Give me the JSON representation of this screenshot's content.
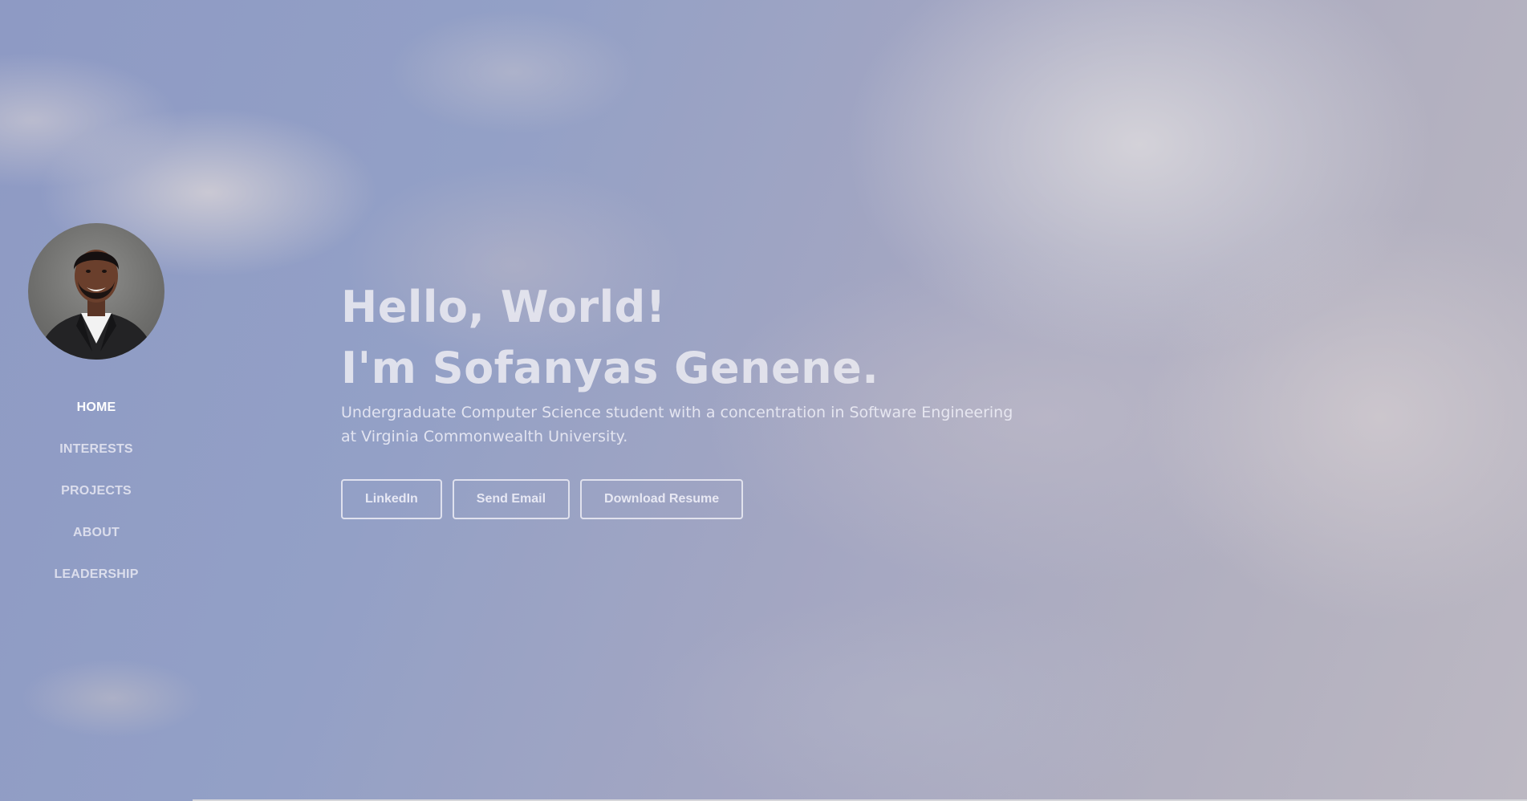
{
  "sidebar": {
    "avatar_alt": "Profile photo",
    "nav": [
      {
        "label": "HOME",
        "active": true
      },
      {
        "label": "INTERESTS",
        "active": false
      },
      {
        "label": "PROJECTS",
        "active": false
      },
      {
        "label": "ABOUT",
        "active": false
      },
      {
        "label": "LEADERSHIP",
        "active": false
      }
    ]
  },
  "hero": {
    "greeting": "Hello, World!",
    "name_line": "I'm Sofanyas Genene.",
    "description": "Undergraduate Computer Science student with a concentration in Software Engineering at Virginia Commonwealth University.",
    "buttons": {
      "linkedin": "LinkedIn",
      "email": "Send Email",
      "resume": "Download Resume"
    }
  },
  "colors": {
    "text_light": "#ececf4",
    "sky_blue": "#8e9ac4",
    "cloud": "#d6d4da"
  }
}
